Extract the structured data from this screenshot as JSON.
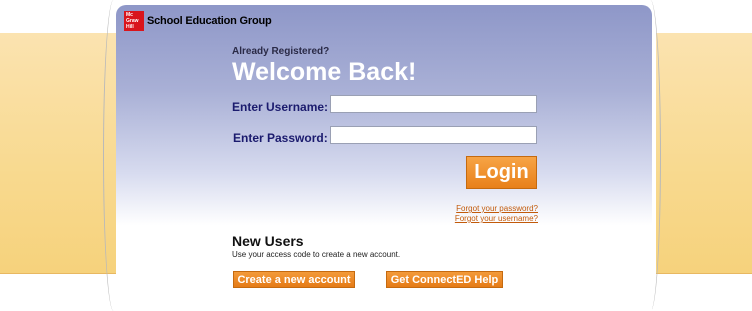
{
  "brand": {
    "logo_lines": [
      "Mc",
      "Graw",
      "Hill"
    ],
    "name": "School Education Group"
  },
  "login": {
    "already_registered": "Already Registered?",
    "welcome": "Welcome Back!",
    "username_label": "Enter Username:",
    "password_label": "Enter Password:",
    "username_value": "",
    "password_value": "",
    "login_button": "Login",
    "forgot_password": "Forgot your password?",
    "forgot_username": "Forgot your username?"
  },
  "new_users": {
    "heading": "New Users",
    "description": "Use your access code to create a new account.",
    "create_account_button": "Create a new account",
    "help_button": "Get ConnectED Help"
  },
  "colors": {
    "accent_orange": "#e8801a",
    "label_blue": "#1b1b6e",
    "logo_red": "#d9141c"
  }
}
